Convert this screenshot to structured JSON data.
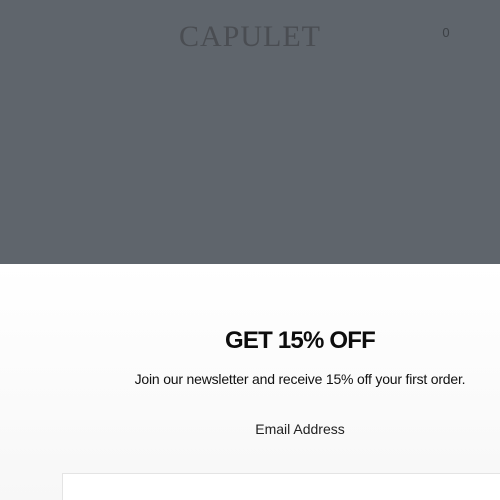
{
  "header": {
    "logo": "CAPULET",
    "cart_count": "0"
  },
  "newsletter": {
    "title": "GET 15% OFF",
    "subtitle": "Join our newsletter and receive 15% off your first order.",
    "email_label": "Email Address",
    "email_value": "",
    "email_placeholder": ""
  },
  "colors": {
    "overlay": "#5f656c",
    "modal_background": "#ffffff",
    "title_text": "#0d0d0d"
  }
}
